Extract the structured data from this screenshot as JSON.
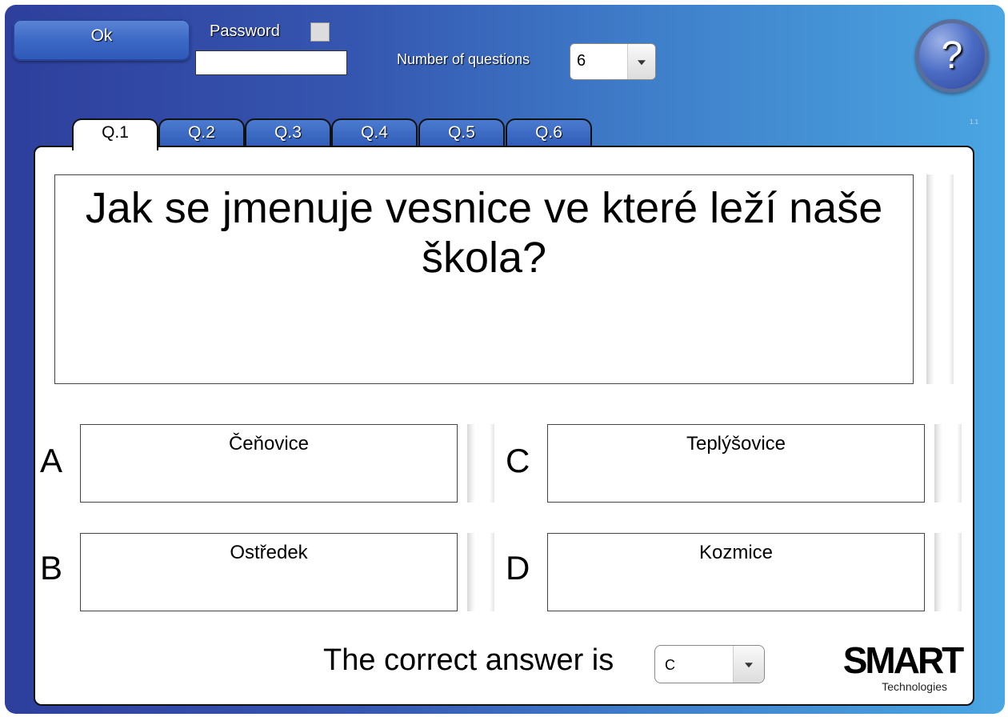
{
  "toolbar": {
    "ok_label": "Ok",
    "password_label": "Password",
    "password_value": "",
    "num_questions_label": "Number of questions",
    "num_questions_value": "6",
    "help_glyph": "?",
    "version": "1.1"
  },
  "tabs": [
    {
      "label": "Q.1",
      "active": true
    },
    {
      "label": "Q.2",
      "active": false
    },
    {
      "label": "Q.3",
      "active": false
    },
    {
      "label": "Q.4",
      "active": false
    },
    {
      "label": "Q.5",
      "active": false
    },
    {
      "label": "Q.6",
      "active": false
    }
  ],
  "question": {
    "text": "Jak se jmenuje vesnice ve které leží naše škola?"
  },
  "answers": [
    {
      "letter": "A",
      "text": "Čeňovice"
    },
    {
      "letter": "B",
      "text": "Ostředek"
    },
    {
      "letter": "C",
      "text": "Teplýšovice"
    },
    {
      "letter": "D",
      "text": "Kozmice"
    }
  ],
  "correct": {
    "label": "The correct answer is",
    "value": "C"
  },
  "logo": {
    "word": "SMART",
    "tagline": "Technologies"
  },
  "colors": {
    "frame_left": "#2e3f9c",
    "frame_right": "#4aa6e2",
    "tab_blue": "#2f5bb7"
  },
  "icons": {
    "help": "question-mark-icon",
    "dropdown": "chevron-down-icon"
  }
}
